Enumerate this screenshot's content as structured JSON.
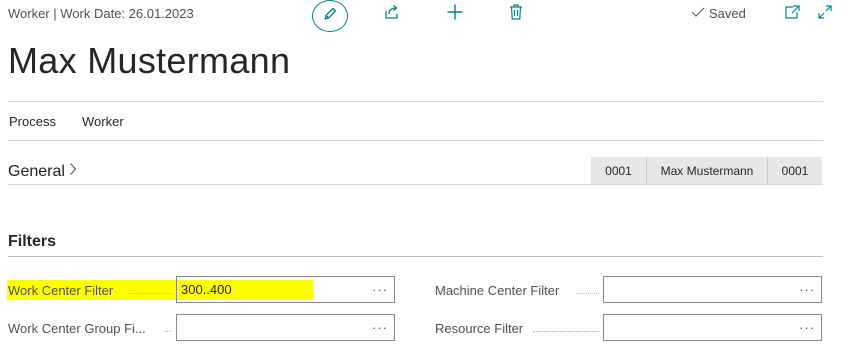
{
  "header": {
    "breadcrumb": "Worker | Work Date: 26.01.2023",
    "saved_label": "Saved"
  },
  "page": {
    "title": "Max Mustermann"
  },
  "menu": {
    "items": [
      {
        "label": "Process"
      },
      {
        "label": "Worker"
      }
    ]
  },
  "general": {
    "label": "General",
    "summary": [
      "0001",
      "Max Mustermann",
      "0001"
    ]
  },
  "filters": {
    "label": "Filters",
    "fields": {
      "work_center_filter": {
        "label": "Work Center Filter",
        "value": "300..400",
        "more": "···"
      },
      "machine_center_filter": {
        "label": "Machine Center Filter",
        "value": "",
        "more": "···"
      },
      "work_center_group_filter": {
        "label": "Work Center Group Fi...",
        "value": "",
        "more": "···"
      },
      "resource_filter": {
        "label": "Resource Filter",
        "value": "",
        "more": "···"
      }
    }
  },
  "colors": {
    "accent": "#00848a",
    "highlight": "#ffff00"
  },
  "icons": [
    "edit-icon",
    "share-icon",
    "add-icon",
    "delete-icon",
    "checkmark-icon",
    "open-new-window-icon",
    "expand-icon",
    "chevron-right-icon"
  ]
}
